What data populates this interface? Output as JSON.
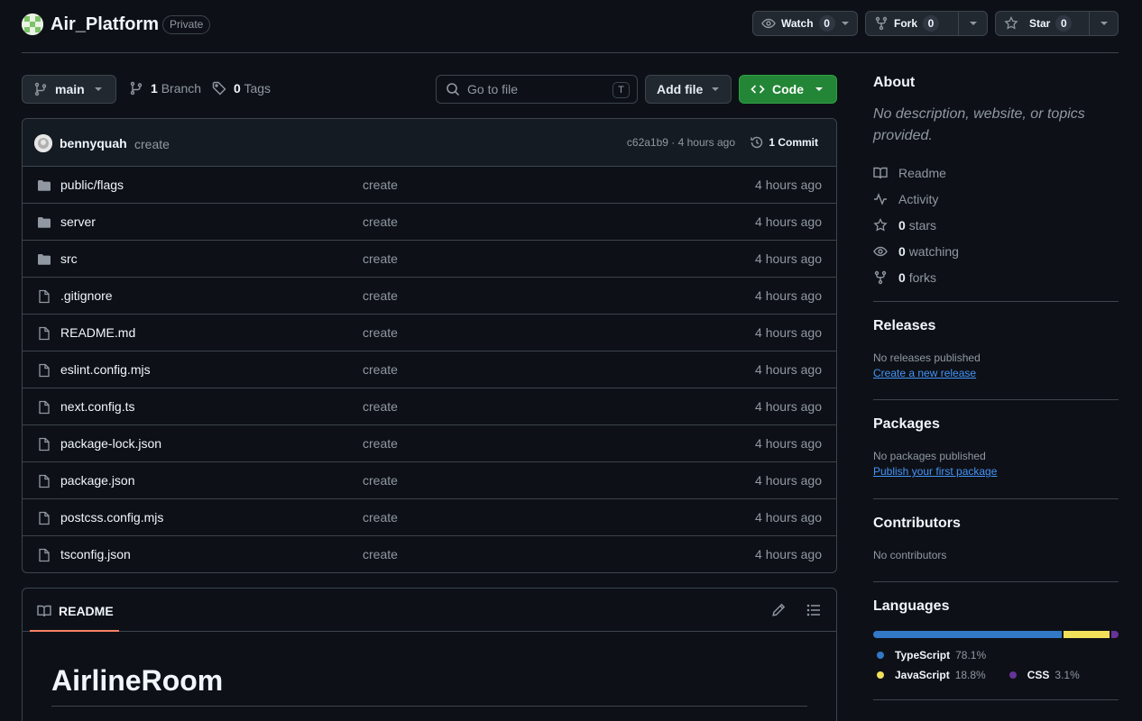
{
  "repo": {
    "name": "Air_Platform",
    "visibility": "Private"
  },
  "actions": {
    "watch": {
      "label": "Watch",
      "count": "0"
    },
    "fork": {
      "label": "Fork",
      "count": "0"
    },
    "star": {
      "label": "Star",
      "count": "0"
    }
  },
  "toolbar": {
    "branch": "main",
    "branch_count": "1",
    "branch_label": "Branch",
    "tag_count": "0",
    "tag_label": "Tags",
    "search_placeholder": "Go to file",
    "search_shortcut": "T",
    "add_file_label": "Add file",
    "code_label": "Code"
  },
  "commit": {
    "author": "bennyquah",
    "message": "create",
    "meta": "c62a1b9 · 4 hours ago",
    "count_label": "1 Commit"
  },
  "files": [
    {
      "type": "folder",
      "name": "public/flags",
      "commit": "create",
      "time": "4 hours ago"
    },
    {
      "type": "folder",
      "name": "server",
      "commit": "create",
      "time": "4 hours ago"
    },
    {
      "type": "folder",
      "name": "src",
      "commit": "create",
      "time": "4 hours ago"
    },
    {
      "type": "file",
      "name": ".gitignore",
      "commit": "create",
      "time": "4 hours ago"
    },
    {
      "type": "file",
      "name": "README.md",
      "commit": "create",
      "time": "4 hours ago"
    },
    {
      "type": "file",
      "name": "eslint.config.mjs",
      "commit": "create",
      "time": "4 hours ago"
    },
    {
      "type": "file",
      "name": "next.config.ts",
      "commit": "create",
      "time": "4 hours ago"
    },
    {
      "type": "file",
      "name": "package-lock.json",
      "commit": "create",
      "time": "4 hours ago"
    },
    {
      "type": "file",
      "name": "package.json",
      "commit": "create",
      "time": "4 hours ago"
    },
    {
      "type": "file",
      "name": "postcss.config.mjs",
      "commit": "create",
      "time": "4 hours ago"
    },
    {
      "type": "file",
      "name": "tsconfig.json",
      "commit": "create",
      "time": "4 hours ago"
    }
  ],
  "readme": {
    "tab_label": "README",
    "title": "AirlineRoom"
  },
  "about": {
    "heading": "About",
    "description": "No description, website, or topics provided.",
    "readme_label": "Readme",
    "activity_label": "Activity",
    "stars_count": "0",
    "stars_label": "stars",
    "watching_count": "0",
    "watching_label": "watching",
    "forks_count": "0",
    "forks_label": "forks"
  },
  "releases": {
    "heading": "Releases",
    "empty": "No releases published",
    "link": "Create a new release"
  },
  "packages": {
    "heading": "Packages",
    "empty": "No packages published",
    "link": "Publish your first package"
  },
  "contributors": {
    "heading": "Contributors",
    "empty": "No contributors"
  },
  "languages": {
    "heading": "Languages",
    "items": [
      {
        "name": "TypeScript",
        "percent": "78.1%",
        "value": 78.1,
        "color": "#3178c6"
      },
      {
        "name": "JavaScript",
        "percent": "18.8%",
        "value": 18.8,
        "color": "#f1e05a"
      },
      {
        "name": "CSS",
        "percent": "3.1%",
        "value": 3.1,
        "color": "#663399"
      }
    ]
  }
}
